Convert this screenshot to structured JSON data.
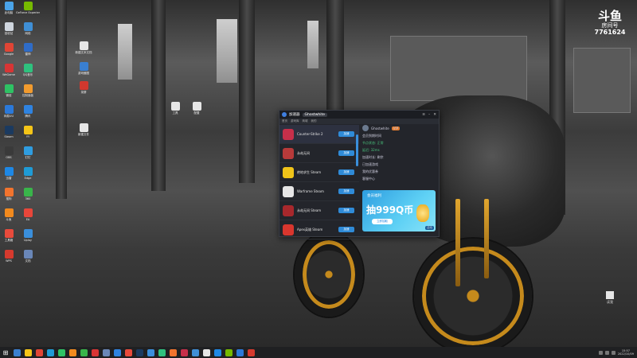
{
  "wallpaper": {
    "description_colors": {
      "wheel": "#c58a1c",
      "body": "#1a1a1a"
    }
  },
  "overlay": {
    "brand_line1": "斗鱼",
    "brand_line2": "房间号",
    "room_number": "7761624"
  },
  "desktop_icons": [
    {
      "label": "此电脑",
      "color": "#4aa3e8"
    },
    {
      "label": "GeForce Experience",
      "color": "#76b900"
    },
    {
      "label": "回收站",
      "color": "#cfd6de"
    },
    {
      "label": "网络",
      "color": "#3f8fd6"
    },
    {
      "label": "Google",
      "color": "#e04535"
    },
    {
      "label": "雷神",
      "color": "#2f6cc7"
    },
    {
      "label": "WeGame",
      "color": "#d83535"
    },
    {
      "label": "QQ音乐",
      "color": "#2ec27e"
    },
    {
      "label": "微信",
      "color": "#2ec264"
    },
    {
      "label": "控制面板",
      "color": "#f29b2e"
    },
    {
      "label": "网易UU",
      "color": "#2b79d9"
    },
    {
      "label": "腾讯",
      "color": "#2f83e0"
    },
    {
      "label": "Steam",
      "color": "#1b3a60"
    },
    {
      "label": "YY",
      "color": "#f5c518"
    },
    {
      "label": "OBS",
      "color": "#3a3a3a"
    },
    {
      "label": "钉钉",
      "color": "#2f9de0"
    },
    {
      "label": "迅雷",
      "color": "#1e88e5"
    },
    {
      "label": "Edge",
      "color": "#1f9bd6"
    },
    {
      "label": "搜狗",
      "color": "#f2742e"
    },
    {
      "label": "360",
      "color": "#39b54a"
    },
    {
      "label": "斗鱼",
      "color": "#f28a1e"
    },
    {
      "label": "EA",
      "color": "#e8463a"
    },
    {
      "label": "工具箱",
      "color": "#e84b3c"
    },
    {
      "label": "Uplay",
      "color": "#3a8fdc"
    },
    {
      "label": "WPS",
      "color": "#d63a2e"
    },
    {
      "label": "文档",
      "color": "#6a87b8"
    }
  ],
  "desktop_files": [
    {
      "label": "新建文本文档",
      "color": "#e6e6e6"
    },
    {
      "label": "游戏截图",
      "color": "#3a7fd0"
    },
    {
      "label": "录屏",
      "color": "#d0382e"
    },
    {
      "label": "工具",
      "color": "#e6e6e6"
    },
    {
      "label": "配置",
      "color": "#e6e6e6"
    },
    {
      "label": "新建文件",
      "color": "#e6e6e6"
    },
    {
      "label": "读我",
      "color": "#e6e6e6"
    }
  ],
  "app_window": {
    "title": "加速器",
    "user": "Ghostwhite",
    "tabs": [
      "首页",
      "游戏库",
      "商城",
      "我的"
    ],
    "games": [
      {
        "name": "Counter-Strike 2",
        "button": "加速",
        "icon_color": "#c72f4a",
        "selected": true
      },
      {
        "name": "永劫无间",
        "button": "加速",
        "icon_color": "#b83a3a"
      },
      {
        "name": "绝地求生 Steam",
        "button": "加速",
        "icon_color": "#f0c419"
      },
      {
        "name": "Warframe Steam",
        "button": "加速",
        "icon_color": "#e6e6e6"
      },
      {
        "name": "永劫无间 Steam",
        "button": "加速",
        "icon_color": "#a8282c"
      },
      {
        "name": "Apex英雄 Steam",
        "button": "加速",
        "icon_color": "#d8362e"
      }
    ],
    "panel_user": "Ghostwhite",
    "panel_badge": "VIP",
    "panel_lines": [
      "会员到期时间",
      "加速时长: 剩余",
      "",
      "已加速游戏",
      "我的优惠券",
      "客服中心"
    ],
    "panel_green": [
      "节点状态: 正常",
      "延迟: 32ms"
    ],
    "banner": {
      "title": "会员福利",
      "main": "抽999Q币",
      "button": "立即抽取",
      "tag": "活动"
    }
  },
  "taskbar": {
    "time": "15:57",
    "date": "2022/10/09",
    "apps": [
      "#3a7fd0",
      "#f5c518",
      "#e04535",
      "#1f9bd6",
      "#2ec264",
      "#f28a1e",
      "#39b54a",
      "#d83535",
      "#6a87b8",
      "#2f83e0",
      "#e84b3c",
      "#1b3a60",
      "#3a8fdc",
      "#2ec27e",
      "#f2742e",
      "#c72f4a",
      "#3f8fd6",
      "#e6e6e6",
      "#1e88e5",
      "#76b900",
      "#2b79d9",
      "#d63a2e"
    ]
  }
}
